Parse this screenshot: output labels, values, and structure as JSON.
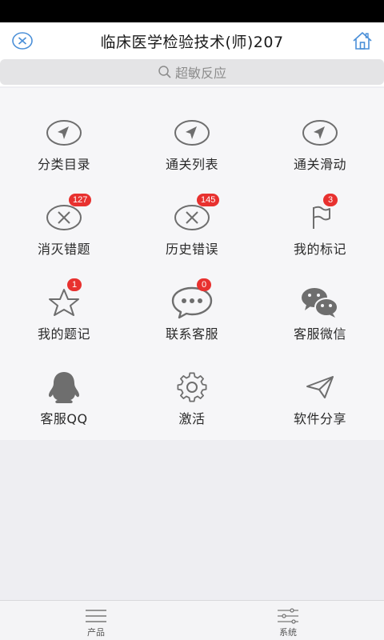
{
  "header": {
    "title": "临床医学检验技术(师)207"
  },
  "search": {
    "placeholder": "超敏反应"
  },
  "menu": [
    {
      "label": "分类目录",
      "icon": "navigation-arrow-icon",
      "badge": ""
    },
    {
      "label": "通关列表",
      "icon": "navigation-arrow-icon",
      "badge": ""
    },
    {
      "label": "通关滑动",
      "icon": "navigation-arrow-icon",
      "badge": ""
    },
    {
      "label": "消灭错题",
      "icon": "x-circle-icon",
      "badge": "127"
    },
    {
      "label": "历史错误",
      "icon": "x-circle-icon",
      "badge": "145"
    },
    {
      "label": "我的标记",
      "icon": "flag-icon",
      "badge": "3"
    },
    {
      "label": "我的题记",
      "icon": "star-icon",
      "badge": "1"
    },
    {
      "label": "联系客服",
      "icon": "chat-bubble-icon",
      "badge": "0"
    },
    {
      "label": "客服微信",
      "icon": "wechat-icon",
      "badge": ""
    },
    {
      "label": "客服QQ",
      "icon": "qq-penguin-icon",
      "badge": ""
    },
    {
      "label": "激活",
      "icon": "gear-icon",
      "badge": ""
    },
    {
      "label": "软件分享",
      "icon": "paper-plane-icon",
      "badge": ""
    }
  ],
  "tabbar": {
    "products_label": "产品",
    "system_label": "系统"
  },
  "colors": {
    "accent": "#4a8fd8",
    "badge": "#e8312f",
    "icon_gray": "#6e6e6e"
  }
}
